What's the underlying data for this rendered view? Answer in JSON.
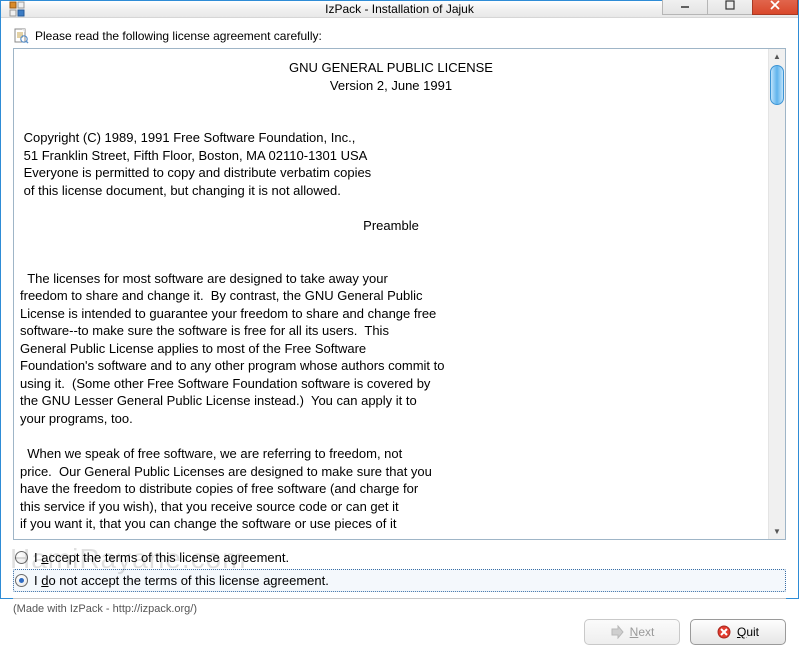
{
  "window": {
    "title": "IzPack - Installation of Jajuk"
  },
  "instruction": "Please read the following license agreement carefully:",
  "license": {
    "heading": "GNU GENERAL PUBLIC LICENSE",
    "version": "Version 2, June 1991",
    "copyright": " Copyright (C) 1989, 1991 Free Software Foundation, Inc.,\n 51 Franklin Street, Fifth Floor, Boston, MA 02110-1301 USA\n Everyone is permitted to copy and distribute verbatim copies\n of this license document, but changing it is not allowed.",
    "preamble_title": "Preamble",
    "body": "  The licenses for most software are designed to take away your\nfreedom to share and change it.  By contrast, the GNU General Public\nLicense is intended to guarantee your freedom to share and change free\nsoftware--to make sure the software is free for all its users.  This\nGeneral Public License applies to most of the Free Software\nFoundation's software and to any other program whose authors commit to\nusing it.  (Some other Free Software Foundation software is covered by\nthe GNU Lesser General Public License instead.)  You can apply it to\nyour programs, too.\n\n  When we speak of free software, we are referring to freedom, not\nprice.  Our General Public Licenses are designed to make sure that you\nhave the freedom to distribute copies of free software (and charge for\nthis service if you wish), that you receive source code or can get it\nif you want it, that you can change the software or use pieces of it"
  },
  "radios": {
    "accept_pre": "I ",
    "accept_u": "a",
    "accept_post": "ccept the terms of this license agreement.",
    "reject_pre": "I ",
    "reject_u": "d",
    "reject_post": "o not accept the terms of this license agreement.",
    "selected": "reject"
  },
  "credit": "(Made with IzPack - http://izpack.org/)",
  "buttons": {
    "next_u": "N",
    "next_post": "ext",
    "quit_u": "Q",
    "quit_post": "uit"
  },
  "watermark": "HamiRayane.com"
}
